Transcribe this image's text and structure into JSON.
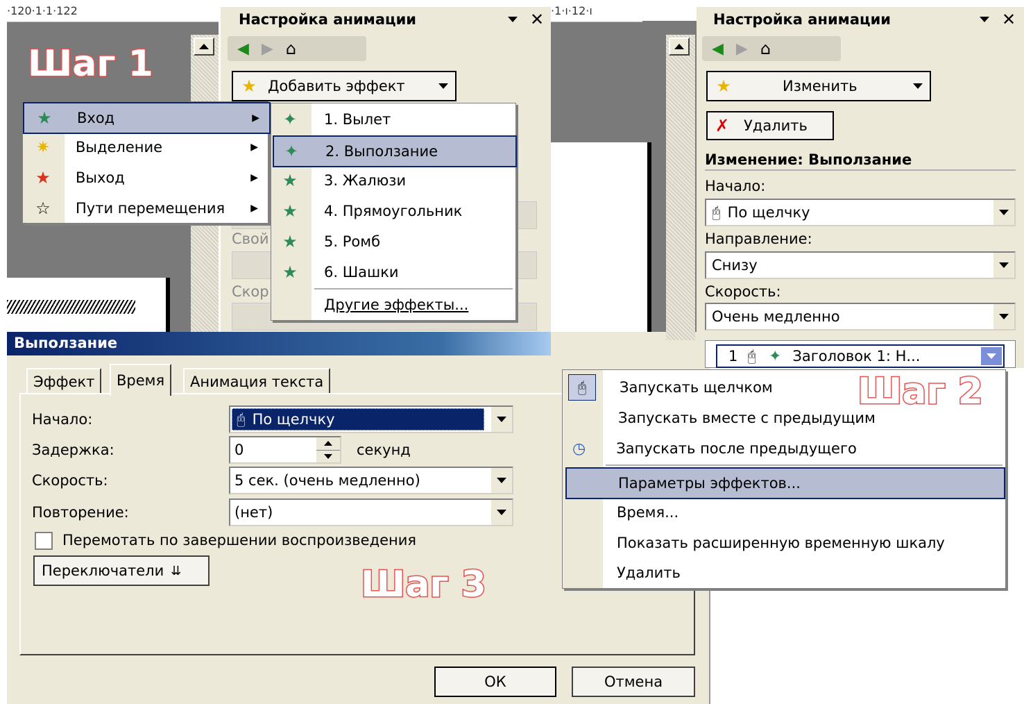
{
  "left_panel": {
    "ruler_ticks": "·120·1·1·122",
    "title": "Настройка анимации",
    "add_effect_label": "Добавить эффект",
    "obscured_label_1": "Свой",
    "obscured_label_2": "Скор"
  },
  "step1": "Шаг 1",
  "step2": "Шаг 2",
  "step3": "Шаг 3",
  "category_menu": {
    "items": [
      {
        "label": "Вход",
        "icon": "entrance-star-icon"
      },
      {
        "label": "Выделение",
        "icon": "emphasis-star-icon"
      },
      {
        "label": "Выход",
        "icon": "exit-star-icon"
      },
      {
        "label": "Пути перемещения",
        "icon": "motion-path-star-icon"
      }
    ]
  },
  "effects_menu": {
    "items": [
      "1. Вылет",
      "2. Выползание",
      "3. Жалюзи",
      "4. Прямоугольник",
      "5. Ромб",
      "6. Шашки"
    ],
    "more": "Другие эффекты..."
  },
  "right_panel": {
    "ruler_ticks": "·1·ı·12·ı",
    "title": "Настройка анимации",
    "change_label": "Изменить",
    "delete_label": "Удалить",
    "section_title": "Изменение: Выползание",
    "start_label": "Начало:",
    "start_value": "По щелчку",
    "direction_label": "Направление:",
    "direction_value": "Снизу",
    "speed_label": "Скорость:",
    "speed_value": "Очень медленно",
    "list_item": {
      "index": "1",
      "text": "Заголовок 1: Н..."
    }
  },
  "context_menu": {
    "items": [
      "Запускать щелчком",
      "Запускать вместе с предыдущим",
      "Запускать после предыдущего",
      "Параметры эффектов...",
      "Время...",
      "Показать расширенную временную шкалу",
      "Удалить"
    ]
  },
  "dialog": {
    "title": "Выползание",
    "tabs": [
      "Эффект",
      "Время",
      "Анимация текста"
    ],
    "start_label": "Начало:",
    "start_value": "По щелчку",
    "delay_label": "Задержка:",
    "delay_value": "0",
    "delay_unit": "секунд",
    "speed_label": "Скорость:",
    "speed_value": "5 сек. (очень медленно)",
    "repeat_label": "Повторение:",
    "repeat_value": "(нет)",
    "rewind_label": "Перемотать по завершении воспроизведения",
    "triggers_label": "Переключатели",
    "ok_label": "ОК",
    "cancel_label": "Отмена"
  },
  "colors": {
    "title_bar": "#0a246a",
    "highlight": "#b6bdd2",
    "step_outline": "#e04040"
  }
}
